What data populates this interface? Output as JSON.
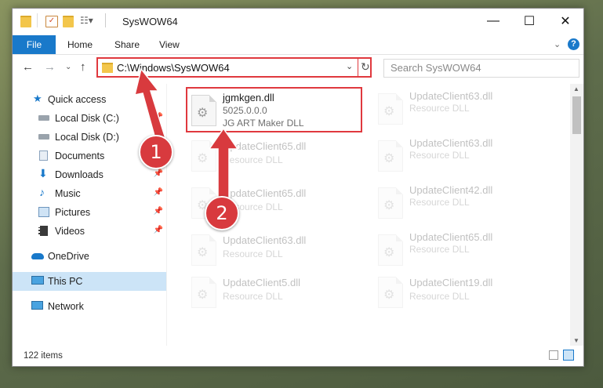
{
  "window": {
    "title": "SysWOW64"
  },
  "ribbon": {
    "tabs": [
      "File",
      "Home",
      "Share",
      "View"
    ]
  },
  "address": {
    "path": "C:\\Windows\\SysWOW64",
    "search_placeholder": "Search SysWOW64"
  },
  "sidebar": {
    "items": [
      {
        "label": "Quick access",
        "icon": "star-icon"
      },
      {
        "label": "Local Disk (C:)",
        "icon": "drive-icon",
        "pinned": true
      },
      {
        "label": "Local Disk (D:)",
        "icon": "drive-icon",
        "pinned": true
      },
      {
        "label": "Documents",
        "icon": "documents-icon",
        "pinned": true
      },
      {
        "label": "Downloads",
        "icon": "downloads-icon",
        "pinned": true
      },
      {
        "label": "Music",
        "icon": "music-icon",
        "pinned": true
      },
      {
        "label": "Pictures",
        "icon": "pictures-icon",
        "pinned": true
      },
      {
        "label": "Videos",
        "icon": "videos-icon",
        "pinned": true
      },
      {
        "label": "OneDrive",
        "icon": "onedrive-icon"
      },
      {
        "label": "This PC",
        "icon": "pc-icon",
        "selected": true
      },
      {
        "label": "Network",
        "icon": "network-icon"
      }
    ]
  },
  "files": {
    "highlighted": {
      "name": "jgmkgen.dll",
      "version": "5025.0.0.0",
      "description": "JG ART Maker DLL"
    },
    "left": [
      {
        "name": "UpdateClient65.dll",
        "type": "Resource DLL"
      },
      {
        "name": "UpdateClient65.dll",
        "type": "Resource DLL"
      },
      {
        "name": "UpdateClient63.dll",
        "type": "Resource DLL"
      },
      {
        "name": "UpdateClient5.dll",
        "type": "Resource DLL"
      }
    ],
    "right": [
      {
        "name": "UpdateClient63.dll",
        "type": "Resource DLL"
      },
      {
        "name": "UpdateClient63.dll",
        "type": "Resource DLL"
      },
      {
        "name": "UpdateClient42.dll",
        "type": "Resource DLL"
      },
      {
        "name": "UpdateClient65.dll",
        "type": "Resource DLL"
      },
      {
        "name": "UpdateClient19.dll",
        "type": "Resource DLL"
      }
    ]
  },
  "status": {
    "item_count": "122 items"
  },
  "annotations": {
    "step1": "1",
    "step2": "2",
    "color": "#d83a3e"
  }
}
